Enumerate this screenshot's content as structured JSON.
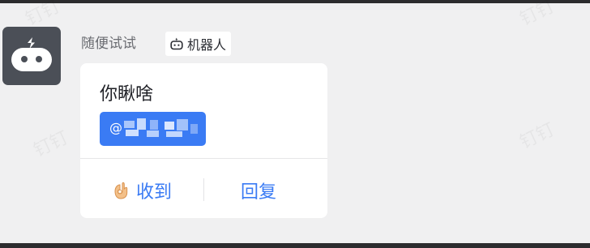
{
  "message": {
    "sender_name": "随便试试",
    "sender_tag": "机器人",
    "text": "你瞅啥",
    "mention_label": "@"
  },
  "actions": {
    "acknowledge_label": "收到",
    "reply_label": "回复"
  },
  "watermark": {
    "text": "钉钉"
  },
  "icons": {
    "avatar": "robot-icon",
    "tag": "robot-small-icon",
    "acknowledge": "ok-hand-icon"
  },
  "colors": {
    "accent": "#3a7bf4",
    "avatar_bg": "#4b4f57",
    "page_bg": "#f0f0f1"
  }
}
